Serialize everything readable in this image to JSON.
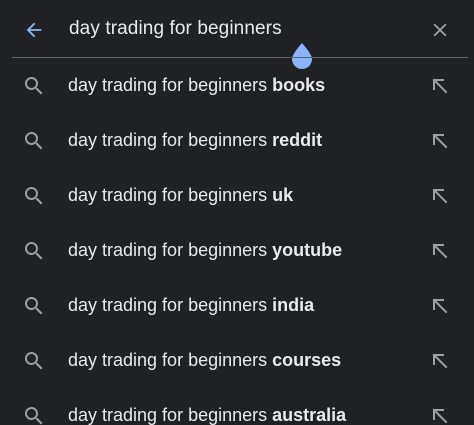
{
  "search": {
    "query": "day trading for beginners",
    "back_icon": "arrow-back-icon",
    "clear_icon": "close-icon"
  },
  "colors": {
    "background": "#202124",
    "text": "#e8eaed",
    "accent": "#8ab4f8",
    "icon": "#9aa0a6",
    "divider": "#5f6368"
  },
  "suggestions": [
    {
      "prefix": "day trading for beginners ",
      "completion": "books",
      "icon": "search-icon",
      "action_icon": "arrow-up-left-icon"
    },
    {
      "prefix": "day trading for beginners ",
      "completion": "reddit",
      "icon": "search-icon",
      "action_icon": "arrow-up-left-icon"
    },
    {
      "prefix": "day trading for beginners ",
      "completion": "uk",
      "icon": "search-icon",
      "action_icon": "arrow-up-left-icon"
    },
    {
      "prefix": "day trading for beginners ",
      "completion": "youtube",
      "icon": "search-icon",
      "action_icon": "arrow-up-left-icon"
    },
    {
      "prefix": "day trading for beginners ",
      "completion": "india",
      "icon": "search-icon",
      "action_icon": "arrow-up-left-icon"
    },
    {
      "prefix": "day trading for beginners ",
      "completion": "courses",
      "icon": "search-icon",
      "action_icon": "arrow-up-left-icon"
    },
    {
      "prefix": "day trading for beginners ",
      "completion": "australia",
      "icon": "search-icon",
      "action_icon": "arrow-up-left-icon"
    }
  ]
}
